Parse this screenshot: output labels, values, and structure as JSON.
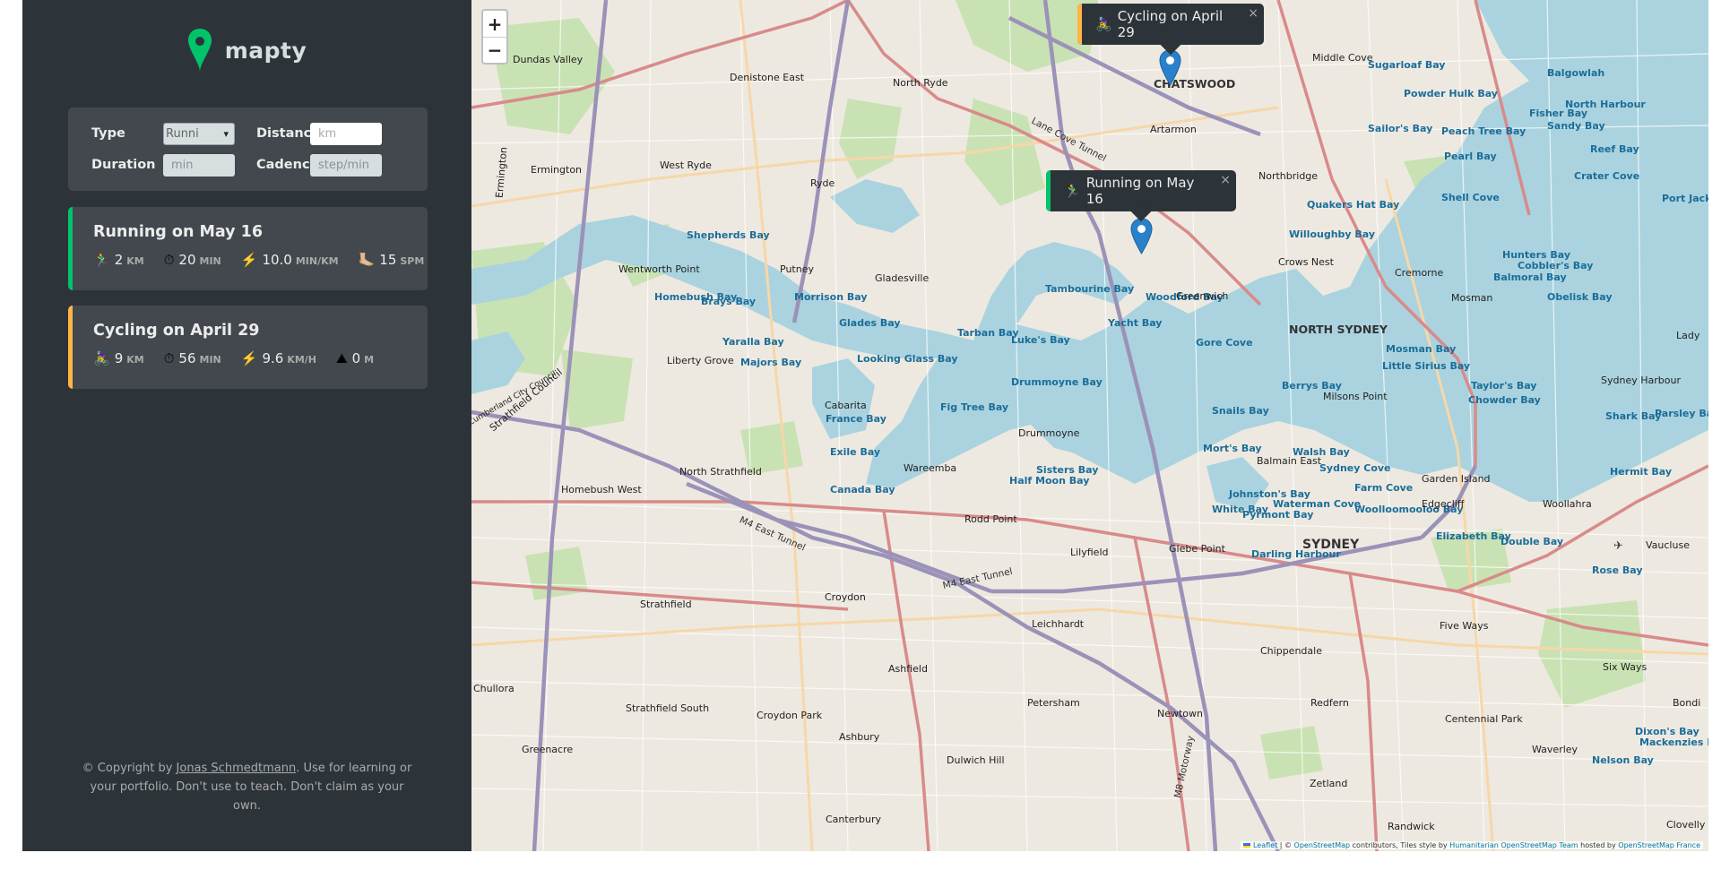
{
  "app": {
    "name": "mapty",
    "brand_color": "#00c46a",
    "secondary_color": "#ffb545"
  },
  "form": {
    "type_label": "Type",
    "type_value": "Runni",
    "distance_label": "Distance",
    "distance_placeholder": "km",
    "duration_label": "Duration",
    "duration_placeholder": "min",
    "cadence_label": "Cadence",
    "cadence_placeholder": "step/min"
  },
  "workouts": [
    {
      "type": "running",
      "title": "Running on May 16",
      "details": [
        {
          "icon": "🏃‍♂️",
          "value": "2",
          "unit": "km"
        },
        {
          "icon": "⏱",
          "value": "20",
          "unit": "min"
        },
        {
          "icon": "⚡️",
          "value": "10.0",
          "unit": "min/km"
        },
        {
          "icon": "🦶🏼",
          "value": "15",
          "unit": "spm"
        }
      ]
    },
    {
      "type": "cycling",
      "title": "Cycling on April 29",
      "details": [
        {
          "icon": "🚴‍♀️",
          "value": "9",
          "unit": "km"
        },
        {
          "icon": "⏱",
          "value": "56",
          "unit": "min"
        },
        {
          "icon": "⚡️",
          "value": "9.6",
          "unit": "km/h"
        },
        {
          "icon": "⛰",
          "value": "0",
          "unit": "m"
        }
      ]
    }
  ],
  "copyright": {
    "prefix": "© Copyright by ",
    "author": "Jonas Schmedtmann",
    "suffix": ". Use for learning or your portfolio. Don't use to teach. Don't claim as your own."
  },
  "map": {
    "zoom_in": "+",
    "zoom_out": "−",
    "popups": [
      {
        "type": "cycling",
        "icon": "🚴‍♀️",
        "text": "Cycling on April 29"
      },
      {
        "type": "running",
        "icon": "🏃‍♂️",
        "text": "Running on May 16"
      }
    ],
    "close_symbol": "×",
    "labels": {
      "chatswood": "CHATSWOOD",
      "north_sydney": "NORTH SYDNEY",
      "sydney": "SYDNEY",
      "lane_cove_tunnel": "Lane Cove Tunnel",
      "m4_east_tunnel_1": "M4 East Tunnel",
      "m4_east_tunnel_2": "M4 East Tunnel",
      "m8_motorway": "M8 Motorway",
      "homebush_bay": "Homebush Bay",
      "brays_bay": "Brays Bay",
      "morrison_bay": "Morrison Bay",
      "glades_bay": "Glades Bay",
      "tarban_bay": "Tarban Bay",
      "woodford_bay": "Woodford Bay",
      "tambourine_bay": "Tambourine Bay",
      "yacht_bay": "Yacht Bay",
      "gore_cove": "Gore Cove",
      "looking_glass_bay": "Looking Glass Bay",
      "lukes_bay": "Luke's Bay",
      "yaralla_bay": "Yaralla Bay",
      "majors_bay": "Majors Bay",
      "france_bay": "France Bay",
      "fig_tree_bay": "Fig Tree Bay",
      "drummoyne_bay": "Drummoyne Bay",
      "exile_bay": "Exile Bay",
      "canada_bay": "Canada Bay",
      "half_moon_bay": "Half Moon Bay",
      "sisters_bay": "Sisters Bay",
      "snails_bay": "Snails Bay",
      "berrys_bay": "Berrys Bay",
      "morts_bay": "Mort's Bay",
      "walsh_bay": "Walsh Bay",
      "sydney_cove": "Sydney Cove",
      "farm_cove": "Farm Cove",
      "woolloomooloo_bay": "Woolloomooloo Bay",
      "elizabeth_bay": "Elizabeth Bay",
      "double_bay": "Double Bay",
      "rose_bay": "Rose Bay",
      "white_bay": "White Bay",
      "johnstons_bay": "Johnston's Bay",
      "waterman_cove": "Waterman Cove",
      "pyrmont_bay": "Pyrmont Bay",
      "darling_harbour": "Darling Harbour",
      "mosman_bay": "Mosman Bay",
      "little_sirius_bay": "Little Sirius Bay",
      "taylors_bay": "Taylor's Bay",
      "chowder_bay": "Chowder Bay",
      "shell_cove": "Shell Cove",
      "willoughby_bay": "Willoughby Bay",
      "quakers_hat_bay": "Quakers Hat Bay",
      "powder_hulk_bay": "Powder Hulk Bay",
      "sugarloaf_bay": "Sugarloaf Bay",
      "pearl_bay": "Pearl Bay",
      "hunters_bay": "Hunters Bay",
      "balmoral_bay": "Balmoral Bay",
      "obelisk_bay": "Obelisk Bay",
      "shark_bay": "Shark Bay",
      "hermit_bay": "Hermit Bay",
      "shepherds_bay": "Shepherds Bay",
      "west_ryde": "West Ryde",
      "ryde": "Ryde",
      "putney": "Putney",
      "gladesville": "Gladesville",
      "drummoyne": "Drummoyne",
      "five_dock": "Wareemba",
      "rodd_point": "Rodd Point",
      "lilyfield": "Lilyfield",
      "leichhardt": "Leichhardt",
      "croydon": "Croydon",
      "strathfield": "Strathfield",
      "ashfield": "Ashfield",
      "petersham": "Petersham",
      "newtown": "Newtown",
      "redfern": "Redfern",
      "chippendale": "Chippendale",
      "zetland": "Zetland",
      "randwick": "Randwick",
      "waverley": "Waverley",
      "bondi": "Bondi",
      "five_ways": "Five Ways",
      "six_ways": "Six Ways",
      "dulwich_hill": "Dulwich Hill",
      "ashbury": "Ashbury",
      "canterbury": "Canterbury",
      "greenacre": "Greenacre",
      "chullora": "Chullora",
      "strathfield_south": "Strathfield South",
      "croydon_park": "Croydon Park",
      "ermington": "Ermington",
      "dundas_valley": "Dundas Valley",
      "denistone_east": "Denistone East",
      "north_ryde": "North Ryde",
      "artarmon": "Artarmon",
      "northbridge": "Northbridge",
      "cremorne": "Cremorne",
      "mosman": "Mosman",
      "crows_nest": "Crows Nest",
      "greenwich": "Greenwich",
      "middle_cove": "Middle Cove",
      "balgowlah": "Balgowlah",
      "north_harbour": "North Harbour",
      "reef_bay": "Reef Bay",
      "crater_cove": "Crater Cove",
      "port_jackson": "Port Jackson",
      "sydney_harbour": "Sydney Harbour",
      "parsley_bay": "Parsley Bay",
      "vaucluse": "Vaucluse",
      "lady": "Lady",
      "fisher_bay": "Fisher Bay",
      "sandy_bay": "Sandy Bay",
      "sailors_bay": "Sailor's Bay",
      "peach_tree_bay": "Peach Tree Bay",
      "cobblers_bay": "Cobbler's Bay",
      "edgecliff": "Edgecliff",
      "woollahra": "Woollahra",
      "centennial_park": "Centennial Park",
      "nelson_bay": "Nelson Bay",
      "mackenzies_bay": "Mackenzies Bay",
      "dixons_bay": "Dixon's Bay",
      "clovelly": "Clovelly",
      "homebush_west": "Homebush West",
      "north_strathfield": "North Strathfield",
      "cabarita": "Cabarita",
      "wentworth_point": "Wentworth Point",
      "liberty_grove": "Liberty Grove",
      "glebe_point": "Glebe Point",
      "balmain_east": "Balmain East",
      "milsons_point": "Milsons Point",
      "garden_island": "Garden Island",
      "strathfield_council": "Strathfield Council",
      "cumberland_council": "Cumberland City Council"
    },
    "attribution": {
      "leaflet": "Leaflet",
      "sep1": " | © ",
      "osm": "OpenStreetMap",
      "mid": " contributors, Tiles style by ",
      "hot": "Humanitarian OpenStreetMap Team",
      "hosted": " hosted by ",
      "osmfr": "OpenStreetMap France"
    }
  }
}
